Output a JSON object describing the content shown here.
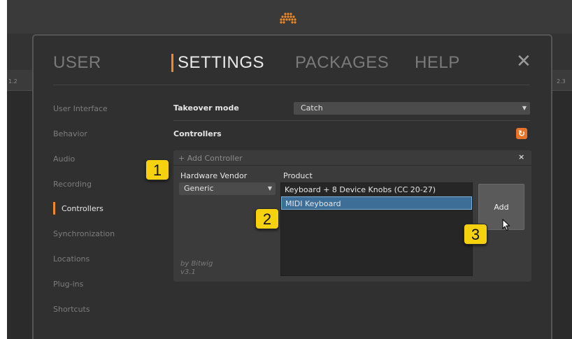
{
  "nav": {
    "user": "USER",
    "settings": "SETTINGS",
    "packages": "PACKAGES",
    "help": "HELP",
    "close": "✕"
  },
  "side_numbers": {
    "left": "1.2",
    "right": "2.3"
  },
  "sidebar": {
    "items": [
      {
        "label": "User Interface"
      },
      {
        "label": "Behavior"
      },
      {
        "label": "Audio"
      },
      {
        "label": "Recording"
      },
      {
        "label": "Controllers"
      },
      {
        "label": "Synchronization"
      },
      {
        "label": "Locations"
      },
      {
        "label": "Plug-ins"
      },
      {
        "label": "Shortcuts"
      }
    ],
    "active": "Controllers"
  },
  "settings": {
    "takeover_label": "Takeover mode",
    "takeover_value": "Catch",
    "controllers_label": "Controllers"
  },
  "panel": {
    "add_controller": "+ Add Controller",
    "close": "×",
    "vendor_label": "Hardware Vendor",
    "vendor_value": "Generic",
    "product_label": "Product",
    "products": [
      {
        "label": "Keyboard + 8 Device Knobs (CC 20-27)"
      },
      {
        "label": "MIDI Keyboard"
      }
    ],
    "selected_product": "MIDI Keyboard",
    "add_button": "Add",
    "by_line": "by Bitwig",
    "version": "v3.1"
  },
  "callouts": [
    "1",
    "2",
    "3"
  ],
  "colors": {
    "accent": "#f08a24",
    "selection": "#3c6e98",
    "callout": "#f5d10e"
  },
  "icons": {
    "logo": "bitwig-logo-icon",
    "refresh": "refresh-icon",
    "cursor": "mouse-pointer-icon"
  }
}
